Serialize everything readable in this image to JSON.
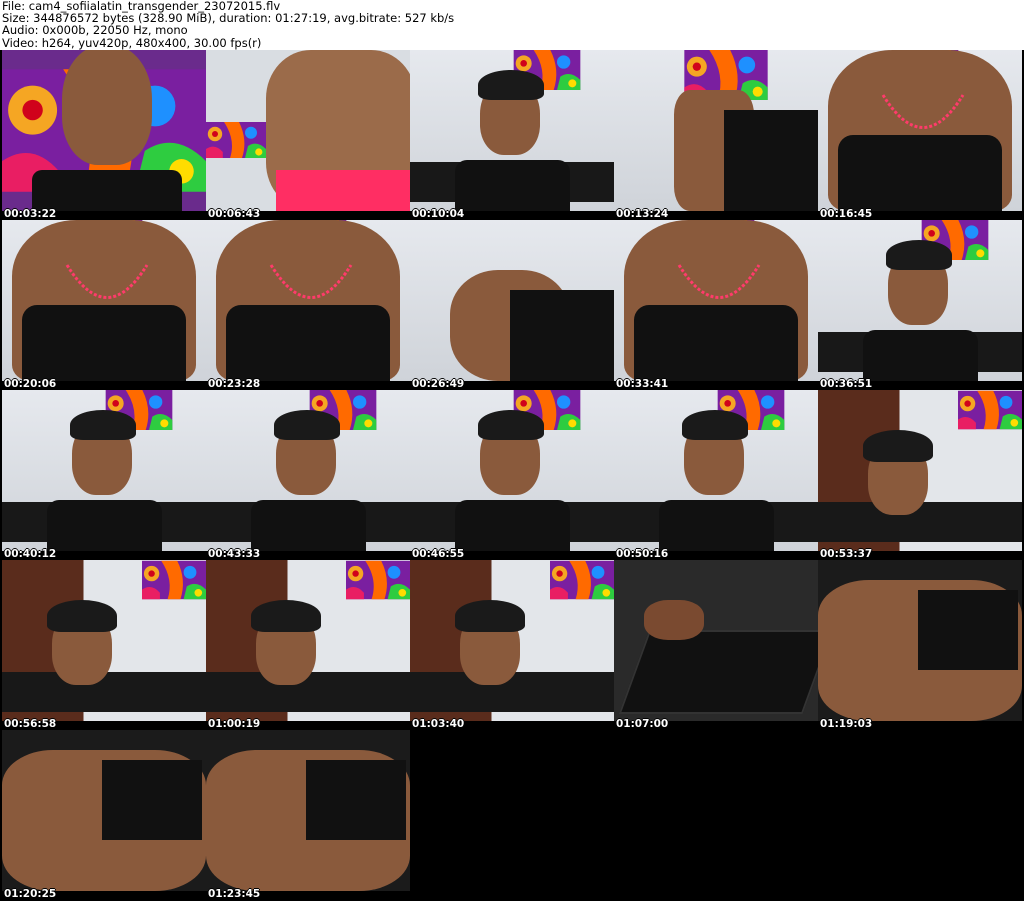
{
  "header": {
    "line1": "File: cam4_sofiialatin_transgender_23072015.flv",
    "line2": "Size: 344876572 bytes (328.90 MiB), duration: 01:27:19, avg.bitrate: 527 kb/s",
    "line3": "Audio: 0x000b, 22050 Hz, mono",
    "line4": "Video: h264, yuv420p, 480x400, 30.00 fps(r)"
  },
  "thumbnails": [
    {
      "timestamp": "00:03:22"
    },
    {
      "timestamp": "00:06:43"
    },
    {
      "timestamp": "00:10:04"
    },
    {
      "timestamp": "00:13:24"
    },
    {
      "timestamp": "00:16:45"
    },
    {
      "timestamp": "00:20:06"
    },
    {
      "timestamp": "00:23:28"
    },
    {
      "timestamp": "00:26:49"
    },
    {
      "timestamp": "00:33:41"
    },
    {
      "timestamp": "00:36:51"
    },
    {
      "timestamp": "00:40:12"
    },
    {
      "timestamp": "00:43:33"
    },
    {
      "timestamp": "00:46:55"
    },
    {
      "timestamp": "00:50:16"
    },
    {
      "timestamp": "00:53:37"
    },
    {
      "timestamp": "00:56:58"
    },
    {
      "timestamp": "01:00:19"
    },
    {
      "timestamp": "01:03:40"
    },
    {
      "timestamp": "01:07:00"
    },
    {
      "timestamp": "01:19:03"
    },
    {
      "timestamp": "01:20:25"
    },
    {
      "timestamp": "01:23:45"
    }
  ]
}
